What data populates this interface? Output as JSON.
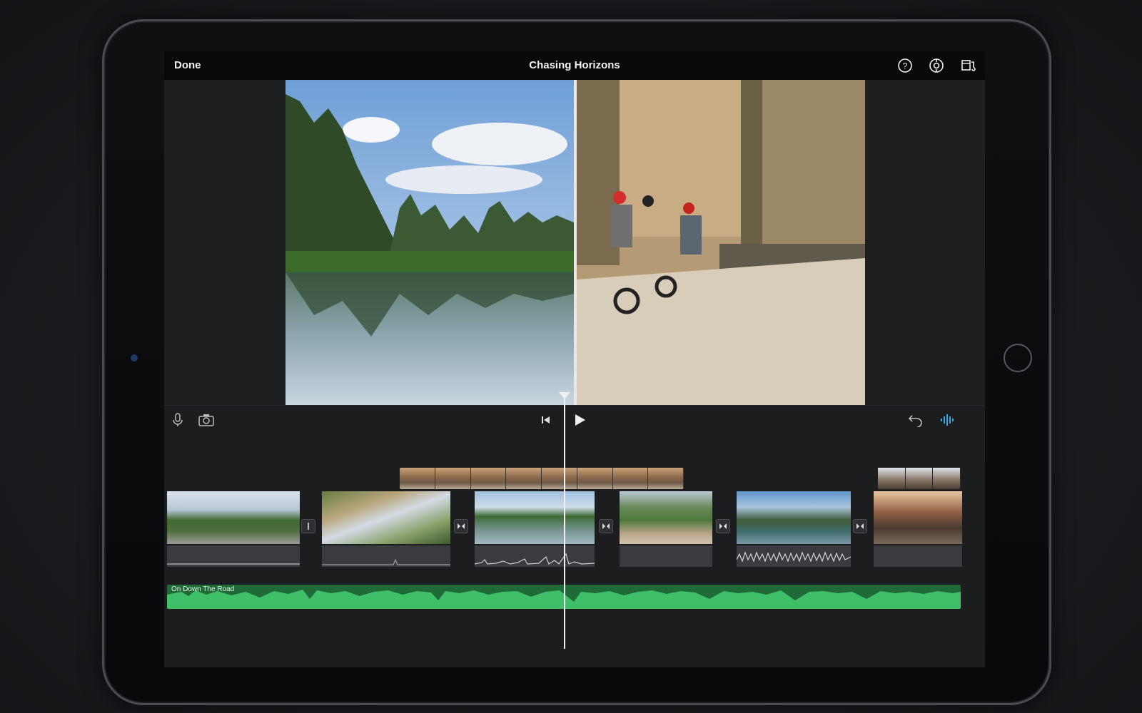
{
  "header": {
    "done_label": "Done",
    "title": "Chasing Horizons",
    "icons": [
      "help-icon",
      "settings-icon",
      "project-settings-icon"
    ]
  },
  "toolbar": {
    "left_icons": [
      "microphone-icon",
      "camera-icon"
    ],
    "center_icons": [
      "skip-to-start-icon",
      "play-icon"
    ],
    "right_icons": [
      "undo-icon",
      "audio-waveform-icon"
    ]
  },
  "timeline": {
    "music_track_label": "On Down The Road",
    "clips": [
      "clip-1",
      "clip-2",
      "clip-3",
      "clip-4",
      "clip-5",
      "clip-6"
    ],
    "accent_color": "#2fa85a",
    "waveform_icon_color": "#3aa8e0"
  }
}
